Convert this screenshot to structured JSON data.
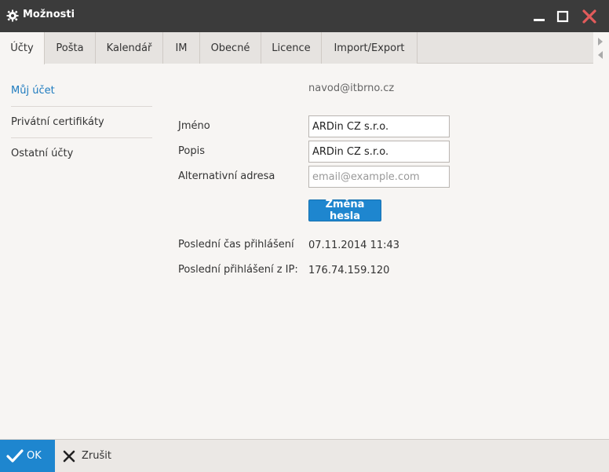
{
  "window": {
    "title": "Možnosti",
    "accent": "#1e86cf",
    "close_color": "#e25b5b"
  },
  "tabs": [
    {
      "label": "Účty",
      "active": true
    },
    {
      "label": "Pošta"
    },
    {
      "label": "Kalendář"
    },
    {
      "label": "IM"
    },
    {
      "label": "Obecné"
    },
    {
      "label": "Licence"
    },
    {
      "label": "Import/Export"
    }
  ],
  "sidebar": {
    "items": [
      {
        "label": "Můj účet",
        "active": true
      },
      {
        "label": "Privátní certifikáty"
      },
      {
        "label": "Ostatní účty"
      }
    ]
  },
  "account": {
    "email": "navod@itbrno.cz",
    "name_label": "Jméno",
    "name_value": "ARDin CZ s.r.o.",
    "desc_label": "Popis",
    "desc_value": "ARDin CZ s.r.o.",
    "alt_label": "Alternativní adresa",
    "alt_value": "",
    "alt_placeholder": "email@example.com",
    "change_password": "Změna hesla",
    "last_login_label": "Poslední čas přihlášení",
    "last_login_value": "07.11.2014 11:43",
    "last_ip_label": "Poslední přihlášení z IP:",
    "last_ip_value": "176.74.159.120"
  },
  "footer": {
    "ok_label": "OK",
    "cancel_label": "Zrušit"
  }
}
